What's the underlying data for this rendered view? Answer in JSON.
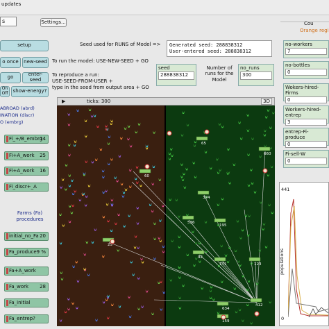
{
  "top": {
    "updates_label": "updates",
    "dropdown_value": "s",
    "settings_label": "Settings..."
  },
  "seed_panel": {
    "title": "Seed used for RUNS of Model =>",
    "generated": "Generated seed: 288838312",
    "user_entered": "User-entered seed: 288838312",
    "run_text": "To run the model: USE-NEW-SEED + GO",
    "reproduce_text": "To reproduce a run:\nUSE-SEED-FROM-USER +\ntype in the seed from output area + GO",
    "seed_label": "seed",
    "seed_value": "288838312",
    "runs_label": "Number of runs for the Model",
    "no_runs_label": "no_runs",
    "no_runs_value": "300"
  },
  "buttons": {
    "setup": "setup",
    "go_once": "o once",
    "new_seed": "new-seed",
    "go": "go",
    "enter_seed": "enter-seed",
    "energy_switch": "On\nOff",
    "show_energy": "show-energy?"
  },
  "left_labels": {
    "abroad": "ABROAD (abrd)",
    "discr": "INATION (discr)",
    "embrg": "O (embrg)",
    "farms_header": "Farms (Fa)\nprocedures"
  },
  "sliders": [
    {
      "label": "Fi_+/B_embrg",
      "value": "14"
    },
    {
      "label": "Fi+A_work",
      "value": "25"
    },
    {
      "label": "Fi+A_work",
      "value": "16"
    },
    {
      "label": "Fi_discr+_A",
      "value": ""
    },
    {
      "label": "initial_no_Fa",
      "value": "20"
    },
    {
      "label": "Fa_produce",
      "value": "9 %"
    },
    {
      "label": "Fa+A_work",
      "value": ""
    },
    {
      "label": "Fa_work",
      "value": "28"
    },
    {
      "label": "Fa_initial",
      "value": ""
    },
    {
      "label": "Fa_entrep?",
      "value": ""
    }
  ],
  "world": {
    "ticks_label": "ticks: 300",
    "view_3d": "3D"
  },
  "agents": {
    "labels": [
      "60",
      "65",
      "660",
      "324",
      "536",
      "195",
      "92",
      "171",
      "123",
      "25",
      "634",
      "412",
      "159"
    ]
  },
  "right": {
    "top_text": "Cou",
    "orange_text": "Orange regi",
    "monitors": [
      {
        "label": "no-workers",
        "value": "7"
      },
      {
        "label": "no-bottles",
        "value": "0"
      },
      {
        "label": "Wokers-hired-Firms",
        "value": "0"
      },
      {
        "label": "Workers-hired-entrep",
        "value": "3"
      },
      {
        "label": "entrep-Fi-produce",
        "value": "0"
      },
      {
        "label": "Fi-sell-W",
        "value": "0"
      }
    ],
    "plot": {
      "ymax": "441",
      "ylabel": "populations",
      "x0": "0"
    }
  },
  "colors": {
    "soil_brown": "#3a1f10",
    "forest_green": "#0c3a10",
    "slider_green": "#8fc5a5",
    "button_teal": "#b9dde2"
  }
}
